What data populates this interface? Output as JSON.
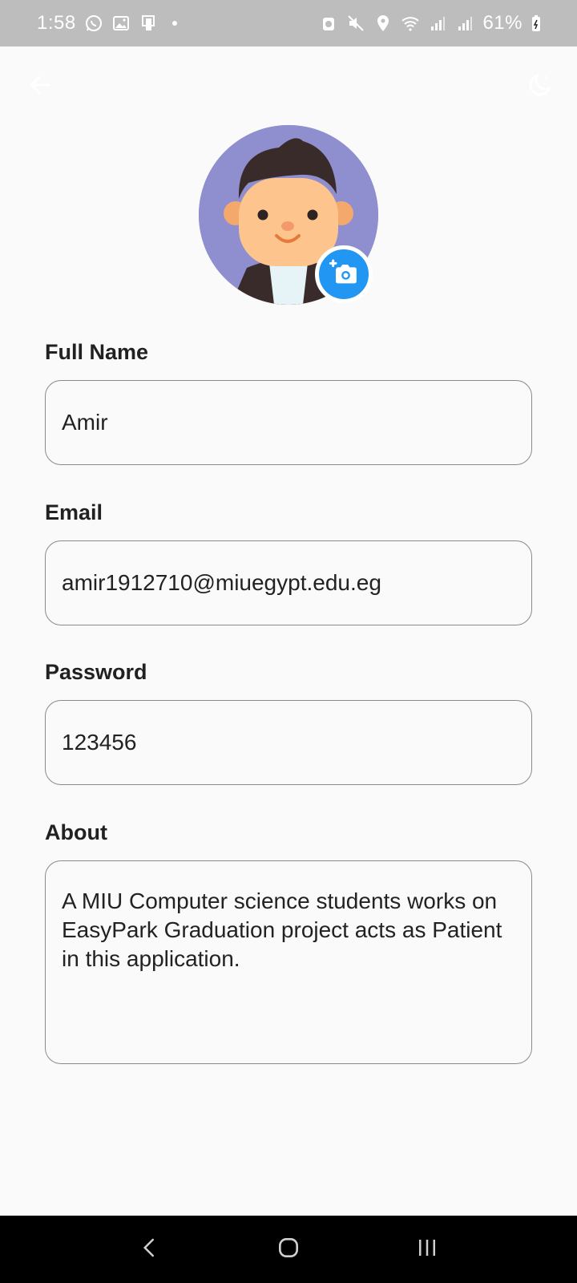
{
  "status_bar": {
    "time": "1:58",
    "battery": "61%",
    "left_icons": [
      "whatsapp-icon",
      "gallery-icon",
      "device-icon"
    ],
    "right_icons": [
      "alarm-icon",
      "mute-icon",
      "location-icon",
      "wifi-icon",
      "signal-icon",
      "signal-icon",
      "battery-icon"
    ]
  },
  "app_bar": {
    "back_icon": "arrow-left-icon",
    "theme_icon": "moon-icon"
  },
  "profile": {
    "avatar_icon": "avatar-boy",
    "camera_icon": "add-camera-icon"
  },
  "form": {
    "full_name": {
      "label": "Full Name",
      "value": "Amir"
    },
    "email": {
      "label": "Email",
      "value": "amir1912710@miuegypt.edu.eg"
    },
    "password": {
      "label": "Password",
      "value": "123456"
    },
    "about": {
      "label": "About",
      "value": "A MIU Computer science students works on EasyPark Graduation project acts as Patient in this application."
    }
  },
  "nav_bar": {
    "icons": [
      "back-nav-icon",
      "home-nav-icon",
      "recents-nav-icon"
    ]
  },
  "colors": {
    "accent": "#2196f3",
    "avatar_bg": "#8f8fcf",
    "status_bar": "#bdbdbd",
    "background": "#fafafa"
  }
}
